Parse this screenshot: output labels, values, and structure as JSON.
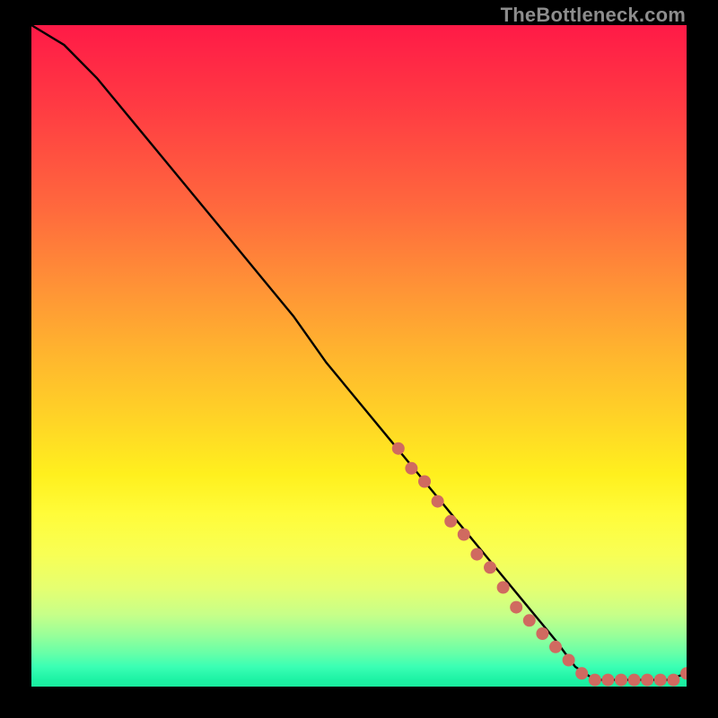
{
  "watermark": "TheBottleneck.com",
  "chart_data": {
    "type": "line",
    "title": "",
    "xlabel": "",
    "ylabel": "",
    "xlim": [
      0,
      100
    ],
    "ylim": [
      0,
      100
    ],
    "curve": {
      "name": "bottleneck-curve",
      "x": [
        0,
        5,
        10,
        15,
        20,
        25,
        30,
        35,
        40,
        45,
        50,
        55,
        60,
        65,
        70,
        75,
        80,
        83,
        86,
        90,
        94,
        97,
        100
      ],
      "y": [
        100,
        97,
        92,
        86,
        80,
        74,
        68,
        62,
        56,
        49,
        43,
        37,
        31,
        25,
        19,
        13,
        7,
        3,
        1,
        1,
        1,
        1,
        2
      ]
    },
    "markers": {
      "name": "highlighted-segment",
      "x": [
        56,
        58,
        60,
        62,
        64,
        66,
        68,
        70,
        72,
        74,
        76,
        78,
        80,
        82,
        84,
        86,
        88,
        90,
        92,
        94,
        96,
        98,
        100
      ],
      "y": [
        36,
        33,
        31,
        28,
        25,
        23,
        20,
        18,
        15,
        12,
        10,
        8,
        6,
        4,
        2,
        1,
        1,
        1,
        1,
        1,
        1,
        1,
        2
      ]
    },
    "colors": {
      "curve": "#000000",
      "marker": "#d06a60"
    }
  }
}
